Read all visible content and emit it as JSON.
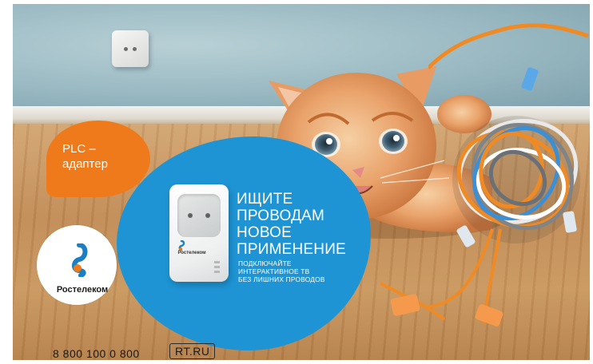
{
  "ad": {
    "product_bubble": {
      "line1": "PLC –",
      "line2": "адаптер"
    },
    "logo": {
      "brand": "Ростелеком"
    },
    "adapter": {
      "brand": "Ростелеком"
    },
    "headline": {
      "lines": [
        "ИЩИТЕ",
        "ПРОВОДАМ",
        "НОВОЕ",
        "ПРИМЕНЕНИЕ"
      ]
    },
    "subline": {
      "lines": [
        "ПОДКЛЮЧАЙТЕ",
        "ИНТЕРАКТИВНОЕ ТВ",
        "БЕЗ ЛИШНИХ ПРОВОДОВ"
      ]
    },
    "phone": "8 800 100 0 800",
    "website": "RT.RU"
  },
  "colors": {
    "brand_orange": "#ee7a1c",
    "brand_blue": "#1e94d4",
    "logo_blue": "#1a7fc4"
  }
}
